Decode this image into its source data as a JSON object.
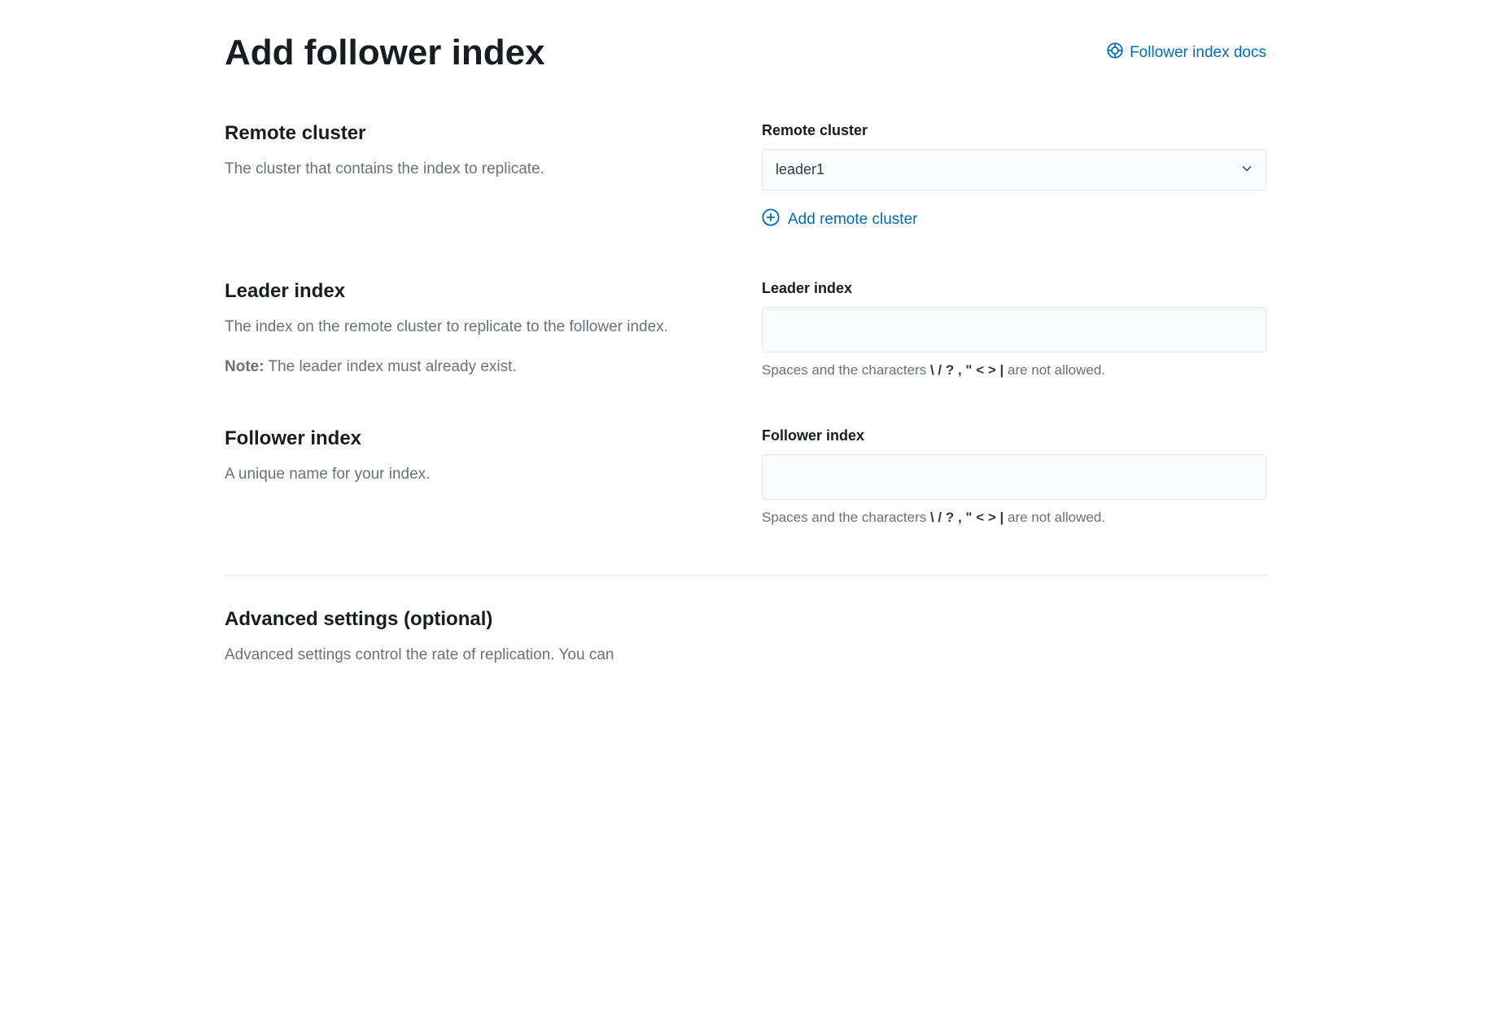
{
  "header": {
    "title": "Add follower index",
    "docs_link_label": "Follower index docs"
  },
  "remote_cluster": {
    "heading": "Remote cluster",
    "description": "The cluster that contains the index to replicate.",
    "field_label": "Remote cluster",
    "selected_value": "leader1",
    "add_link_label": "Add remote cluster"
  },
  "leader_index": {
    "heading": "Leader index",
    "description": "The index on the remote cluster to replicate to the follower index.",
    "note_label": "Note:",
    "note_text": " The leader index must already exist.",
    "field_label": "Leader index",
    "value": "",
    "help_prefix": "Spaces and the characters ",
    "help_chars": "\\ / ? , \" < > |",
    "help_suffix": " are not allowed."
  },
  "follower_index": {
    "heading": "Follower index",
    "description": "A unique name for your index.",
    "field_label": "Follower index",
    "value": "",
    "help_prefix": "Spaces and the characters ",
    "help_chars": "\\ / ? , \" < > |",
    "help_suffix": " are not allowed."
  },
  "advanced": {
    "heading": "Advanced settings (optional)",
    "description": "Advanced settings control the rate of replication. You can"
  }
}
